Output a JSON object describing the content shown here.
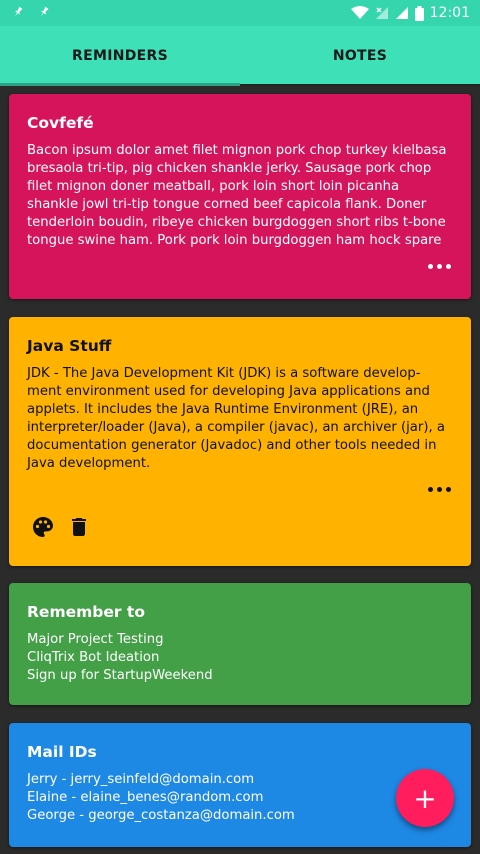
{
  "status_bar": {
    "time": "12:01"
  },
  "tabs": [
    {
      "label": "REMINDERS",
      "active": true
    },
    {
      "label": "NOTES",
      "active": false
    }
  ],
  "cards": [
    {
      "title": "Covfefé",
      "color": "#d6145c",
      "lines": [
        "Bacon ipsum dolor amet filet mignon pork chop turkey kielbasa",
        "bresaola tri-tip, pig chicken shankle jerky. Sausage pork chop",
        "filet mignon doner meatball, pork loin short loin picanha",
        "shankle jowl tri-tip tongue corned beef capicola flank. Doner",
        "tenderloin boudin, ribeye chicken burgdoggen short ribs t-bone",
        "tongue swine ham. Pork pork loin burgdoggen ham hock spare"
      ]
    },
    {
      "title": "Java Stuff",
      "color": "#ffb300",
      "lines": [
        "JDK - The Java Development Kit (JDK) is a software develop-",
        "ment environment used for developing Java applications and",
        "applets. It includes the Java Runtime Environment (JRE), an",
        "interpreter/loader (Java), a compiler (javac), an archiver (jar), a",
        "documentation generator (Javadoc) and other tools needed in",
        "Java development."
      ]
    },
    {
      "title": "Remember to",
      "color": "#43a047",
      "lines": [
        "Major Project Testing",
        "CliqTrix Bot Ideation",
        "Sign up for StartupWeekend"
      ]
    },
    {
      "title": "Mail IDs",
      "color": "#1e88e5",
      "lines": [
        "Jerry - jerry_seinfeld@domain.com",
        "Elaine - elaine_benes@random.com",
        "George - george_costanza@domain.com"
      ]
    }
  ],
  "icons": {
    "pin": "pin-icon",
    "wifi": "wifi-icon",
    "signal": "signal-icon",
    "battery": "battery-icon",
    "more": "more-horizontal-icon",
    "palette": "palette-icon",
    "trash": "trash-icon",
    "add": "plus-icon"
  },
  "fab": {
    "label": "+",
    "color": "#ff1d5e"
  }
}
